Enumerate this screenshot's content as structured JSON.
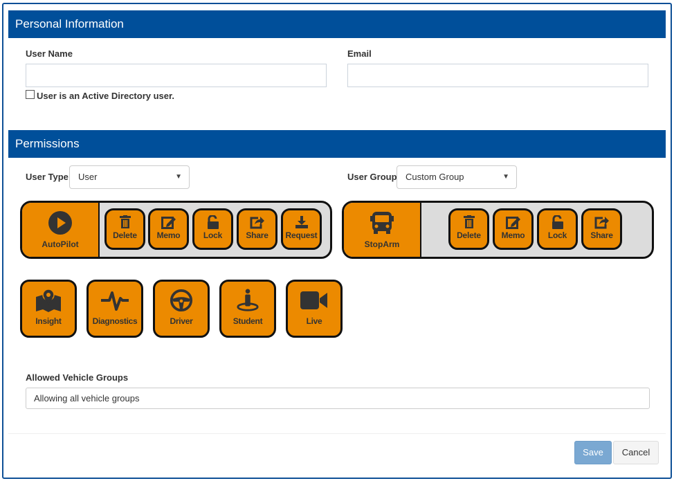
{
  "personal_info": {
    "section_title": "Personal Information",
    "user_name_label": "User Name",
    "user_name_value": "",
    "email_label": "Email",
    "email_value": "",
    "active_directory_label": "User is an Active Directory user.",
    "active_directory_checked": false
  },
  "permissions": {
    "section_title": "Permissions",
    "user_type_label": "User Type",
    "user_type_value": "User",
    "user_group_label": "User Group",
    "user_group_value": "Custom Group",
    "autopilot": {
      "label": "AutoPilot",
      "icon": "play-circle-icon",
      "actions": [
        {
          "label": "Delete",
          "icon": "trash-icon"
        },
        {
          "label": "Memo",
          "icon": "edit-icon"
        },
        {
          "label": "Lock",
          "icon": "unlock-icon"
        },
        {
          "label": "Share",
          "icon": "share-icon"
        },
        {
          "label": "Request",
          "icon": "download-icon"
        }
      ]
    },
    "stoparm": {
      "label": "StopArm",
      "icon": "bus-icon",
      "actions": [
        {
          "label": "Delete",
          "icon": "trash-icon"
        },
        {
          "label": "Memo",
          "icon": "edit-icon"
        },
        {
          "label": "Lock",
          "icon": "unlock-icon"
        },
        {
          "label": "Share",
          "icon": "share-icon"
        }
      ]
    },
    "modules": [
      {
        "label": "Insight",
        "icon": "map-marker-icon"
      },
      {
        "label": "Diagnostics",
        "icon": "heartbeat-icon"
      },
      {
        "label": "Driver",
        "icon": "steering-wheel-icon"
      },
      {
        "label": "Student",
        "icon": "student-icon"
      },
      {
        "label": "Live",
        "icon": "video-camera-icon"
      }
    ],
    "vehicle_groups_label": "Allowed Vehicle Groups",
    "vehicle_groups_value": "Allowing all vehicle groups"
  },
  "footer": {
    "save_label": "Save",
    "cancel_label": "Cancel"
  },
  "colors": {
    "header_blue": "#004f9a",
    "accent_orange": "#ec8a00",
    "save_blue": "#7aa8d2"
  }
}
